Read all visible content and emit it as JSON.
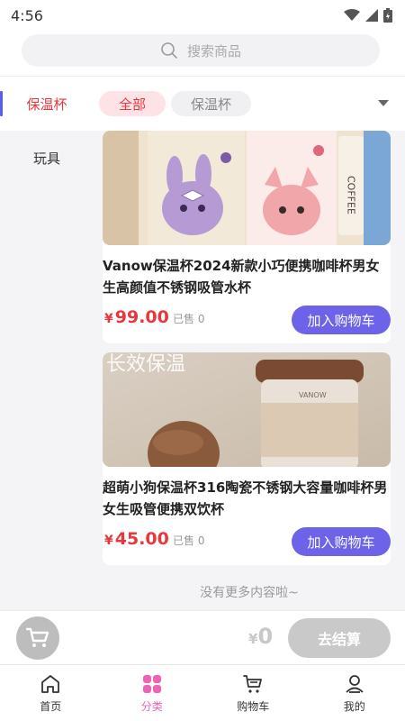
{
  "status_bar": {
    "time": "4:56",
    "icons": [
      "wifi-icon",
      "cellular-signal-icon",
      "battery-icon"
    ]
  },
  "search": {
    "placeholder": "搜索商品",
    "icon": "search-icon"
  },
  "sidebar": {
    "items": [
      {
        "label": "保温杯",
        "active": true
      },
      {
        "label": "玩具",
        "active": false
      }
    ]
  },
  "chips": {
    "items": [
      {
        "label": "全部",
        "active": true
      },
      {
        "label": "保温杯",
        "active": false
      }
    ],
    "more_icon": "chevron-down-icon"
  },
  "products": [
    {
      "title": "Vanow保温杯2024新款小巧便携咖啡杯男女生高颜值不锈钢吸管水杯",
      "price_symbol": "¥",
      "price": "99.00",
      "sold": "已售 0",
      "add_label": "加入购物车",
      "image_text": "COFFEE"
    },
    {
      "title": "超萌小狗保温杯316陶瓷不锈钢大容量咖啡杯男女生吸管便携双饮杯",
      "price_symbol": "¥",
      "price": "45.00",
      "sold": "已售 0",
      "add_label": "加入购物车",
      "image_text": "长效保温",
      "image_brand": "VANOW"
    }
  ],
  "list_footer": "没有更多内容啦~",
  "cart_bar": {
    "currency": "¥",
    "total": "0",
    "checkout_label": "去结算",
    "cart_icon": "shopping-cart-icon"
  },
  "tab_bar": {
    "items": [
      {
        "label": "首页",
        "icon": "home-icon",
        "active": false
      },
      {
        "label": "分类",
        "icon": "category-grid-icon",
        "active": true
      },
      {
        "label": "购物车",
        "icon": "cart-icon",
        "active": false
      },
      {
        "label": "我的",
        "icon": "user-icon",
        "active": false
      }
    ]
  },
  "colors": {
    "accent_red": "#e8383d",
    "button_purple": "#6c63e8",
    "tab_active_pink": "#f062b4",
    "sidebar_bar": "#5b5bf0"
  }
}
